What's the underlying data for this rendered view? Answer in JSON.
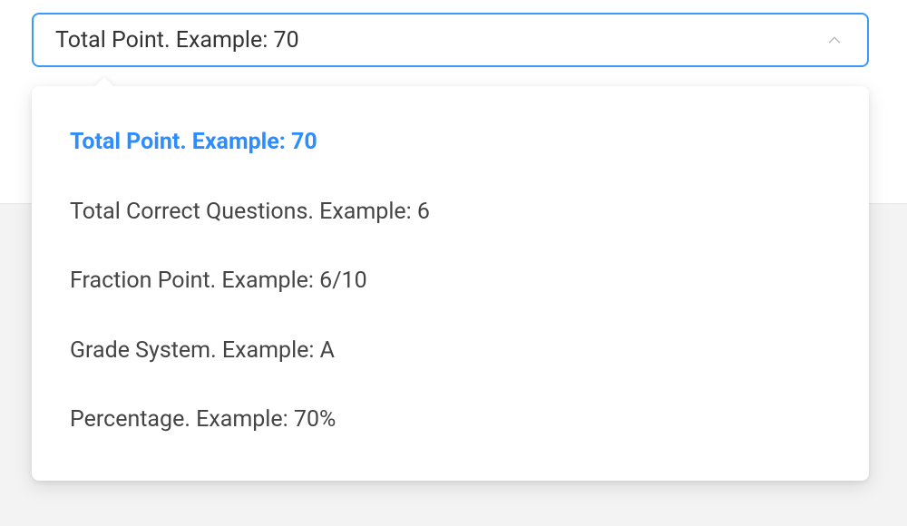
{
  "select": {
    "selected_label": "Total Point. Example: 70",
    "options": [
      {
        "label": "Total Point. Example: 70",
        "selected": true
      },
      {
        "label": "Total Correct Questions. Example: 6",
        "selected": false
      },
      {
        "label": "Fraction Point. Example: 6/10",
        "selected": false
      },
      {
        "label": "Grade System. Example: A",
        "selected": false
      },
      {
        "label": "Percentage. Example: 70%",
        "selected": false
      }
    ]
  }
}
